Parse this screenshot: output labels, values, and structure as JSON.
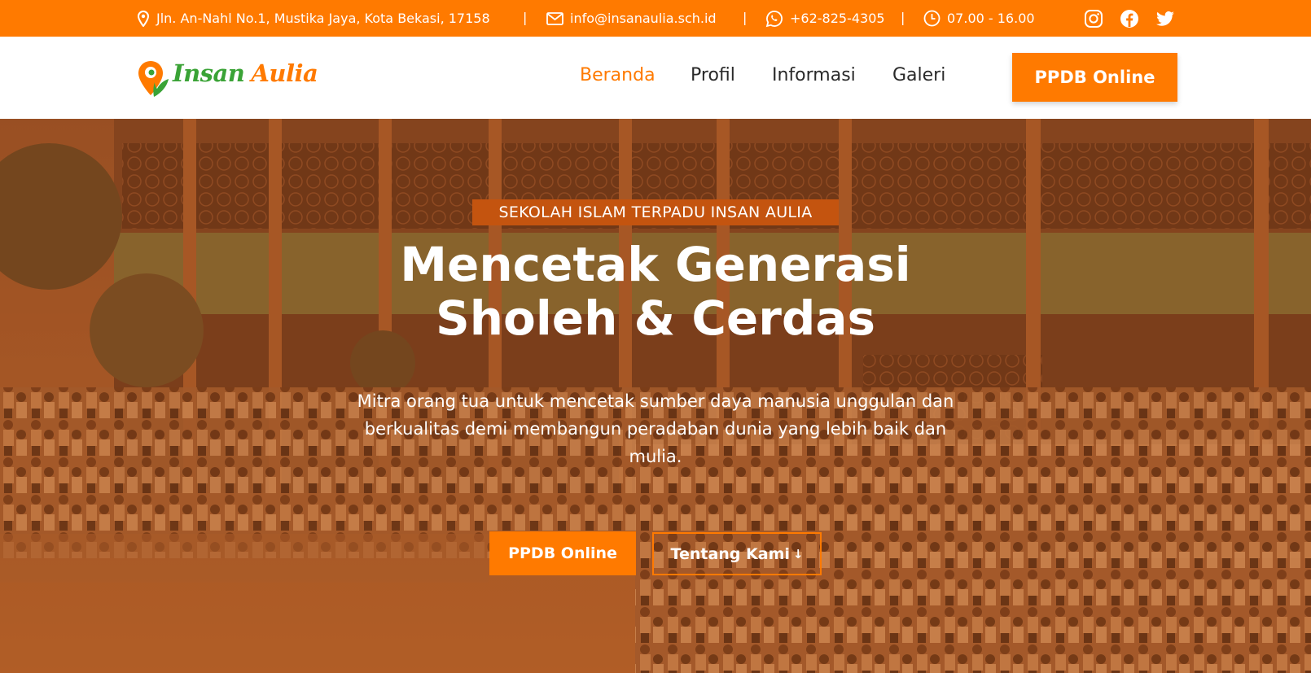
{
  "topbar": {
    "address": "Jln. An-Nahl No.1, Mustika Jaya, Kota Bekasi, 17158",
    "email": "info@insanaulia.sch.id",
    "phone": "+62-825-4305",
    "hours": "07.00 - 16.00",
    "separator": "|",
    "icons": [
      "location-pin-icon",
      "mail-icon",
      "whatsapp-icon",
      "clock-icon",
      "instagram-icon",
      "facebook-icon",
      "twitter-icon"
    ]
  },
  "navbar": {
    "logo_word1": "Insan",
    "logo_word2": "Aulia",
    "links": [
      {
        "label": "Beranda",
        "active": true
      },
      {
        "label": "Profil",
        "active": false
      },
      {
        "label": "Informasi",
        "active": false
      },
      {
        "label": "Galeri",
        "active": false
      }
    ],
    "cta_label": "PPDB Online"
  },
  "hero": {
    "eyebrow": "SEKOLAH ISLAM TERPADU INSAN AULIA",
    "headline_line1": "Mencetak Generasi",
    "headline_line2": "Sholeh & Cerdas",
    "subtext": "Mitra orang tua untuk mencetak sumber daya manusia unggulan dan berkualitas demi membangun peradaban dunia yang lebih baik dan mulia.",
    "primary_button": "PPDB Online",
    "secondary_button": "Tentang Kami",
    "secondary_arrow": "↓"
  },
  "colors": {
    "accent": "#ff7a00",
    "logo_green": "#3aa336",
    "eyebrow_bg": "#c4540f"
  }
}
